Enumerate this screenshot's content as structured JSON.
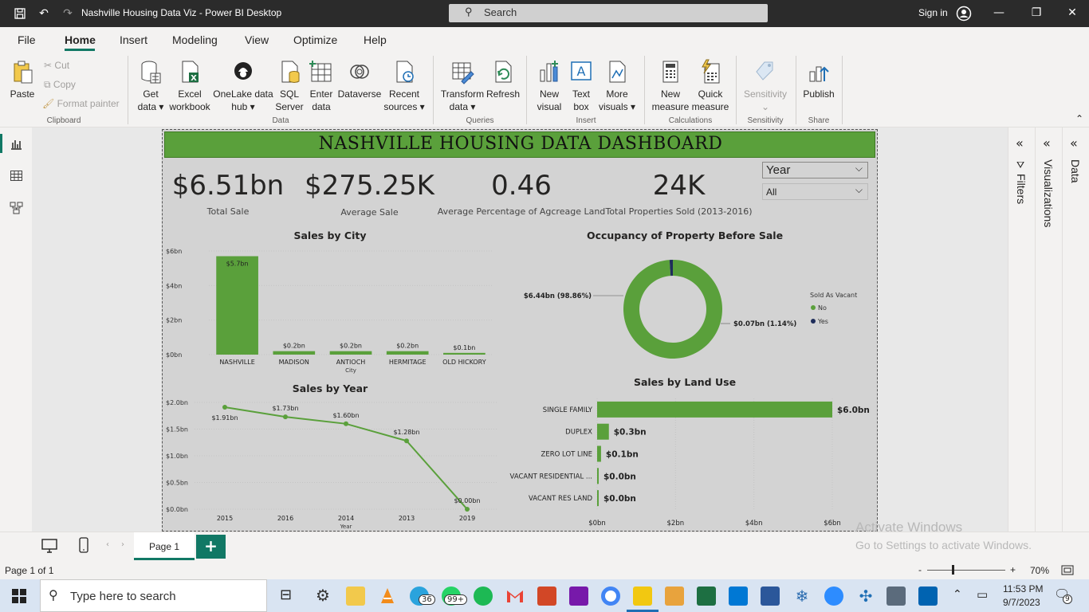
{
  "window": {
    "title": "Nashville Housing Data Viz - Power BI Desktop",
    "search_placeholder": "Search",
    "sign_in": "Sign in"
  },
  "menu": {
    "tabs": [
      "File",
      "Home",
      "Insert",
      "Modeling",
      "View",
      "Optimize",
      "Help"
    ],
    "active": "Home"
  },
  "ribbon": {
    "clipboard": {
      "paste": "Paste",
      "cut": "Cut",
      "copy": "Copy",
      "format_painter": "Format painter",
      "group": "Clipboard"
    },
    "data": {
      "get_data": [
        "Get",
        "data ▾"
      ],
      "excel": [
        "Excel",
        "workbook"
      ],
      "onelake": [
        "OneLake data",
        "hub ▾"
      ],
      "sql": [
        "SQL",
        "Server"
      ],
      "enter": [
        "Enter",
        "data"
      ],
      "dataverse": "Dataverse",
      "recent": [
        "Recent",
        "sources ▾"
      ],
      "group": "Data"
    },
    "queries": {
      "transform": [
        "Transform",
        "data ▾"
      ],
      "refresh": "Refresh",
      "group": "Queries"
    },
    "insert": {
      "new_visual": [
        "New",
        "visual"
      ],
      "text_box": [
        "Text",
        "box"
      ],
      "more_visuals": [
        "More",
        "visuals ▾"
      ],
      "group": "Insert"
    },
    "calculations": {
      "new_measure": [
        "New",
        "measure"
      ],
      "quick_measure": [
        "Quick",
        "measure"
      ],
      "group": "Calculations"
    },
    "sensitivity": {
      "label": "Sensitivity",
      "group": "Sensitivity"
    },
    "share": {
      "publish": "Publish",
      "group": "Share"
    }
  },
  "dashboard": {
    "title": "NASHVILLE HOUSING DATA DASHBOARD",
    "kpis": [
      {
        "value": "$6.51bn",
        "label": "Total Sale"
      },
      {
        "value": "$275.25K",
        "label": "Average Sale"
      },
      {
        "value": "0.46",
        "label": "Average Percentage of Agcreage Land"
      },
      {
        "value": "24K",
        "label": "Total Properties Sold (2013-2016)"
      }
    ],
    "slicer": {
      "field": "Year",
      "value": "All"
    },
    "colors": {
      "green": "#5aa03b",
      "navy": "#1f2d5a",
      "banner": "#5aa03b"
    }
  },
  "chart_data": [
    {
      "type": "bar",
      "title": "Sales by City",
      "xlabel": "City",
      "categories": [
        "NASHVILLE",
        "MADISON",
        "ANTIOCH",
        "HERMITAGE",
        "OLD HICKORY"
      ],
      "values": [
        5.7,
        0.2,
        0.2,
        0.2,
        0.1
      ],
      "data_labels": [
        "$5.7bn",
        "$0.2bn",
        "$0.2bn",
        "$0.2bn",
        "$0.1bn"
      ],
      "y_ticks": [
        "$0bn",
        "$2bn",
        "$4bn",
        "$6bn"
      ],
      "ylim": [
        0,
        6
      ]
    },
    {
      "type": "pie",
      "title": "Occupancy of Property Before Sale",
      "legend_title": "Sold As Vacant",
      "labels": [
        "No",
        "Yes"
      ],
      "values": [
        6.44,
        0.07
      ],
      "data_labels": [
        "$6.44bn (98.86%)",
        "$0.07bn (1.14%)"
      ],
      "colors": [
        "#5aa03b",
        "#1f2d5a"
      ],
      "legend": "right"
    },
    {
      "type": "line",
      "title": "Sales by Year",
      "xlabel": "Year",
      "categories": [
        "2015",
        "2016",
        "2014",
        "2013",
        "2019"
      ],
      "values": [
        1.91,
        1.73,
        1.6,
        1.28,
        0.0
      ],
      "data_labels": [
        "$1.91bn",
        "$1.73bn",
        "$1.60bn",
        "$1.28bn",
        "$0.00bn"
      ],
      "y_ticks": [
        "$0.0bn",
        "$0.5bn",
        "$1.0bn",
        "$1.5bn",
        "$2.0bn"
      ],
      "ylim": [
        0,
        2.0
      ]
    },
    {
      "type": "bar",
      "orientation": "horizontal",
      "title": "Sales by Land Use",
      "categories": [
        "SINGLE FAMILY",
        "DUPLEX",
        "ZERO LOT LINE",
        "VACANT RESIDENTIAL ...",
        "VACANT RES LAND"
      ],
      "values": [
        6.0,
        0.3,
        0.1,
        0.0,
        0.0
      ],
      "data_labels": [
        "$6.0bn",
        "$0.3bn",
        "$0.1bn",
        "$0.0bn",
        "$0.0bn"
      ],
      "x_ticks": [
        "$0bn",
        "$2bn",
        "$4bn",
        "$6bn"
      ],
      "xlim": [
        0,
        6
      ]
    }
  ],
  "panes": [
    "Filters",
    "Visualizations",
    "Data"
  ],
  "pages": {
    "tab": "Page 1",
    "add": "+"
  },
  "watermark": {
    "line1": "Activate Windows",
    "line2": "Go to Settings to activate Windows."
  },
  "status": {
    "page_info": "Page 1 of 1",
    "zoom": "70%",
    "minus": "-",
    "plus": "+"
  },
  "taskbar": {
    "search_placeholder": "Type here to search",
    "time": "11:53 PM",
    "date": "9/7/2023",
    "badges": {
      "telegram": "36",
      "whatsapp": "99+",
      "notifications": "9"
    }
  }
}
